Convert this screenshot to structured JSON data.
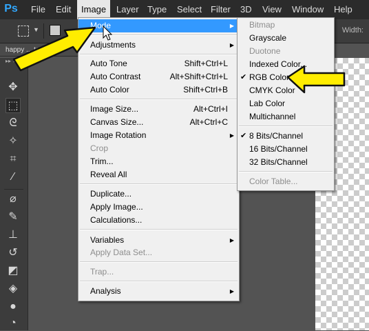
{
  "app": {
    "logo": "Ps"
  },
  "menubar": {
    "items": [
      "File",
      "Edit",
      "Image",
      "Layer",
      "Type",
      "Select",
      "Filter",
      "3D",
      "View",
      "Window",
      "Help"
    ]
  },
  "optionsbar": {
    "width_label": "Width:"
  },
  "document": {
    "tab_label": "happy ... teros"
  },
  "image_menu": {
    "mode": "Mode",
    "adjustments": "Adjustments",
    "auto_tone": "Auto Tone",
    "auto_tone_sc": "Shift+Ctrl+L",
    "auto_contrast": "Auto Contrast",
    "auto_contrast_sc": "Alt+Shift+Ctrl+L",
    "auto_color": "Auto Color",
    "auto_color_sc": "Shift+Ctrl+B",
    "image_size": "Image Size...",
    "image_size_sc": "Alt+Ctrl+I",
    "canvas_size": "Canvas Size...",
    "canvas_size_sc": "Alt+Ctrl+C",
    "image_rotation": "Image Rotation",
    "crop": "Crop",
    "trim": "Trim...",
    "reveal_all": "Reveal All",
    "duplicate": "Duplicate...",
    "apply_image": "Apply Image...",
    "calculations": "Calculations...",
    "variables": "Variables",
    "apply_data_set": "Apply Data Set...",
    "trap": "Trap...",
    "analysis": "Analysis"
  },
  "mode_menu": {
    "bitmap": "Bitmap",
    "grayscale": "Grayscale",
    "duotone": "Duotone",
    "indexed_color": "Indexed Color...",
    "rgb_color": "RGB Color",
    "cmyk_color": "CMYK Color",
    "lab_color": "Lab Color",
    "multichannel": "Multichannel",
    "bits8": "8 Bits/Channel",
    "bits16": "16 Bits/Channel",
    "bits32": "32 Bits/Channel",
    "color_table": "Color Table..."
  },
  "colors": {
    "highlight": "#3399ff",
    "callout": "#ffed00"
  }
}
